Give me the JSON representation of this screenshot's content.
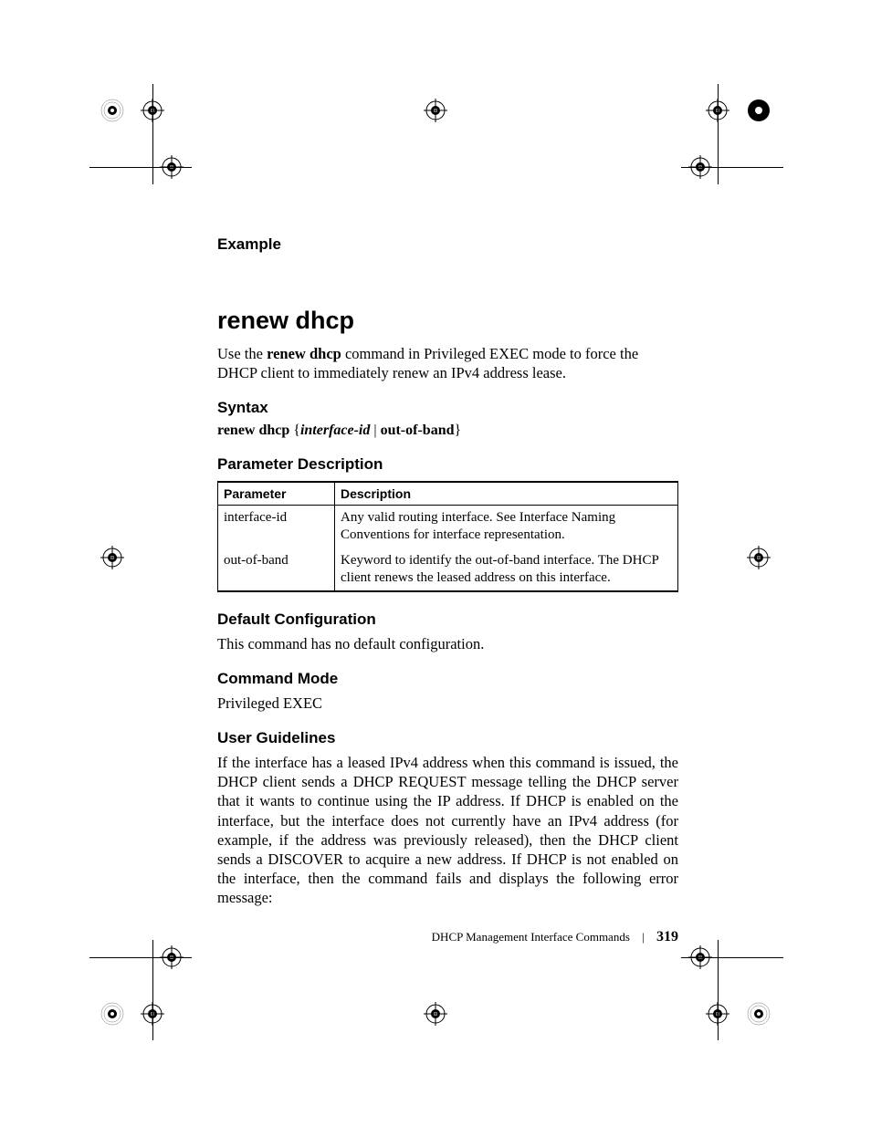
{
  "sections": {
    "example_heading": "Example",
    "title": "renew dhcp",
    "intro_parts": {
      "prefix": "Use the ",
      "cmd": "renew dhcp",
      "suffix": " command in Privileged EXEC mode to force the DHCP client to immediately renew an IPv4 address lease."
    },
    "syntax_heading": "Syntax",
    "syntax_parts": {
      "cmd": "renew dhcp",
      "brace_open": " {",
      "param": "interface-id",
      "pipe": " | ",
      "kw": "out-of-band",
      "brace_close": "}"
    },
    "param_desc_heading": "Parameter Description",
    "table": {
      "headers": {
        "param": "Parameter",
        "desc": "Description"
      },
      "rows": [
        {
          "param": "interface-id",
          "desc": "Any valid routing interface. See Interface Naming Conventions for interface representation."
        },
        {
          "param": "out-of-band",
          "desc": "Keyword to identify the out-of-band interface. The DHCP client renews the leased address on this interface."
        }
      ]
    },
    "default_cfg_heading": "Default Configuration",
    "default_cfg_body": "This command has no default configuration.",
    "cmd_mode_heading": "Command Mode",
    "cmd_mode_body": "Privileged EXEC",
    "user_guidelines_heading": "User Guidelines",
    "user_guidelines_body": "If the interface has a leased IPv4 address when this command is issued, the DHCP client sends a DHCP REQUEST message telling the DHCP server that it wants to continue using the IP address. If DHCP is enabled on the interface, but the interface does not currently have an IPv4 address (for example, if the address was previously released), then the DHCP client sends a DISCOVER to acquire a new address. If DHCP is not enabled on the interface, then the command fails and displays the following error message:"
  },
  "footer": {
    "section_name": "DHCP Management Interface Commands",
    "page_number": "319"
  }
}
